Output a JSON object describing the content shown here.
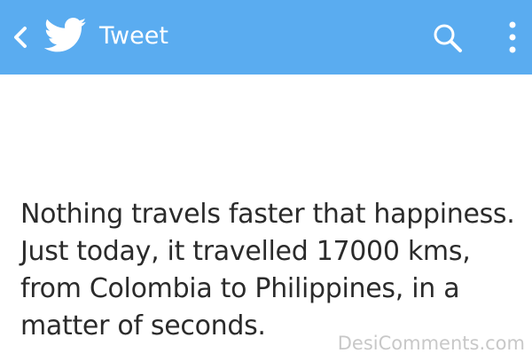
{
  "appbar": {
    "back_icon": "chevron-left-icon",
    "logo_icon": "twitter-bird-icon",
    "title": "Tweet",
    "search_icon": "search-icon",
    "overflow_icon": "more-vertical-icon",
    "background": "#5aacf0"
  },
  "tweet": {
    "lines": [
      "Nothing travels faster that happiness.",
      "Just today, it travelled 17000 kms,",
      "from Colombia to Philippines, in a",
      "matter of seconds."
    ]
  },
  "watermark": "DesiComments.com"
}
